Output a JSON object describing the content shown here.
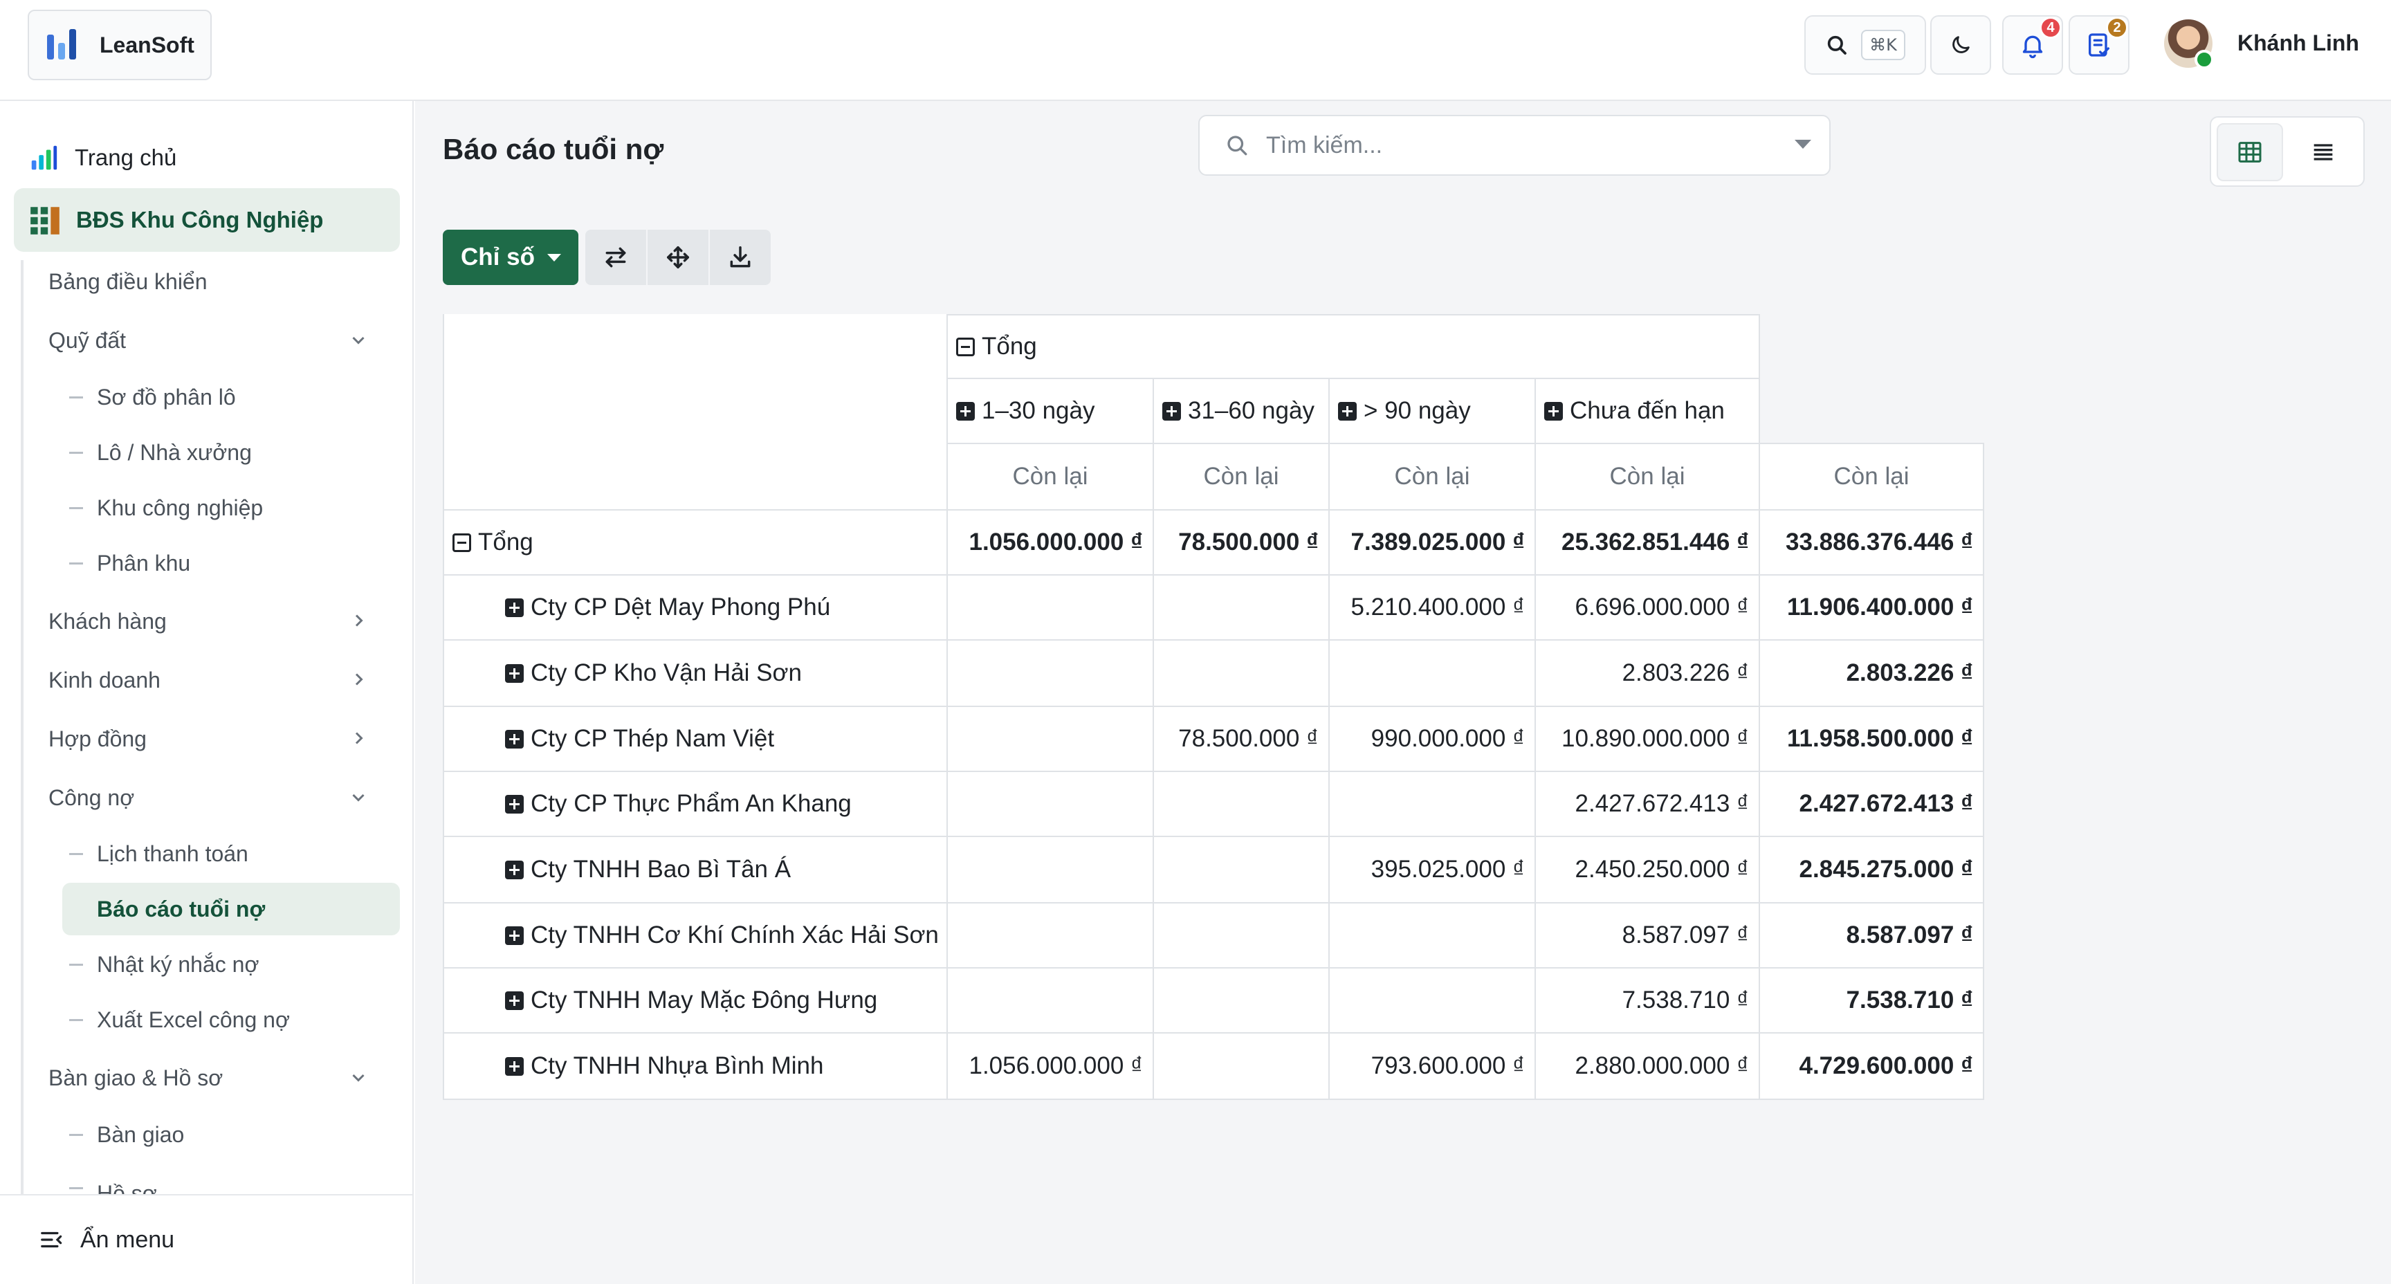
{
  "app": {
    "name": "LeanSoft",
    "search_shortcut": "⌘K",
    "notifications_count": "4",
    "tasks_count": "2",
    "user_name": "Khánh Linh"
  },
  "sidebar": {
    "home": "Trang chủ",
    "module": "BĐS Khu Công Nghiệp",
    "items": {
      "dashboard": "Bảng điều khiển",
      "land": "Quỹ đất",
      "land_map": "Sơ đồ phân lô",
      "lots": "Lô / Nhà xưởng",
      "parks": "Khu công nghiệp",
      "zones": "Phân khu",
      "customers": "Khách hàng",
      "sales": "Kinh doanh",
      "contracts": "Hợp đồng",
      "debts": "Công nợ",
      "payment_schedule": "Lịch thanh toán",
      "aging_report": "Báo cáo tuổi nợ",
      "reminder_log": "Nhật ký nhắc nợ",
      "export_excel": "Xuất Excel công nợ",
      "handover": "Bàn giao & Hồ sơ",
      "handover_sub": "Bàn giao",
      "records_sub": "Hồ sơ"
    },
    "hide_menu": "Ẩn menu"
  },
  "main": {
    "title": "Báo cáo tuổi nợ",
    "search_placeholder": "Tìm kiếm...",
    "measures_button": "Chỉ số"
  },
  "pivot": {
    "col_total": "Tổng",
    "columns": [
      "1–30 ngày",
      "31–60 ngày",
      "> 90 ngày",
      "Chưa đến hạn"
    ],
    "measure": "Còn lại",
    "row_total_label": "Tổng",
    "total_row": [
      "1.056.000.000 ₫",
      "78.500.000 ₫",
      "7.389.025.000 ₫",
      "25.362.851.446 ₫",
      "33.886.376.446 ₫"
    ],
    "rows": [
      {
        "name": "Cty CP Dệt May Phong Phú",
        "values": [
          "",
          "",
          "5.210.400.000 ₫",
          "6.696.000.000 ₫",
          "11.906.400.000 ₫"
        ]
      },
      {
        "name": "Cty CP Kho Vận Hải Sơn",
        "values": [
          "",
          "",
          "",
          "2.803.226 ₫",
          "2.803.226 ₫"
        ]
      },
      {
        "name": "Cty CP Thép Nam Việt",
        "values": [
          "",
          "78.500.000 ₫",
          "990.000.000 ₫",
          "10.890.000.000 ₫",
          "11.958.500.000 ₫"
        ]
      },
      {
        "name": "Cty CP Thực Phẩm An Khang",
        "values": [
          "",
          "",
          "",
          "2.427.672.413 ₫",
          "2.427.672.413 ₫"
        ]
      },
      {
        "name": "Cty TNHH Bao Bì Tân Á",
        "values": [
          "",
          "",
          "395.025.000 ₫",
          "2.450.250.000 ₫",
          "2.845.275.000 ₫"
        ]
      },
      {
        "name": "Cty TNHH Cơ Khí Chính Xác Hải Sơn",
        "values": [
          "",
          "",
          "",
          "8.587.097 ₫",
          "8.587.097 ₫"
        ]
      },
      {
        "name": "Cty TNHH May Mặc Đông Hưng",
        "values": [
          "",
          "",
          "",
          "7.538.710 ₫",
          "7.538.710 ₫"
        ]
      },
      {
        "name": "Cty TNHH Nhựa Bình Minh",
        "values": [
          "1.056.000.000 ₫",
          "",
          "793.600.000 ₫",
          "2.880.000.000 ₫",
          "4.729.600.000 ₫"
        ]
      }
    ]
  },
  "colors": {
    "primary": "#1e6b48",
    "active_bg": "#e7efea",
    "badge_red": "#e5484d",
    "badge_amber": "#b7791f"
  }
}
